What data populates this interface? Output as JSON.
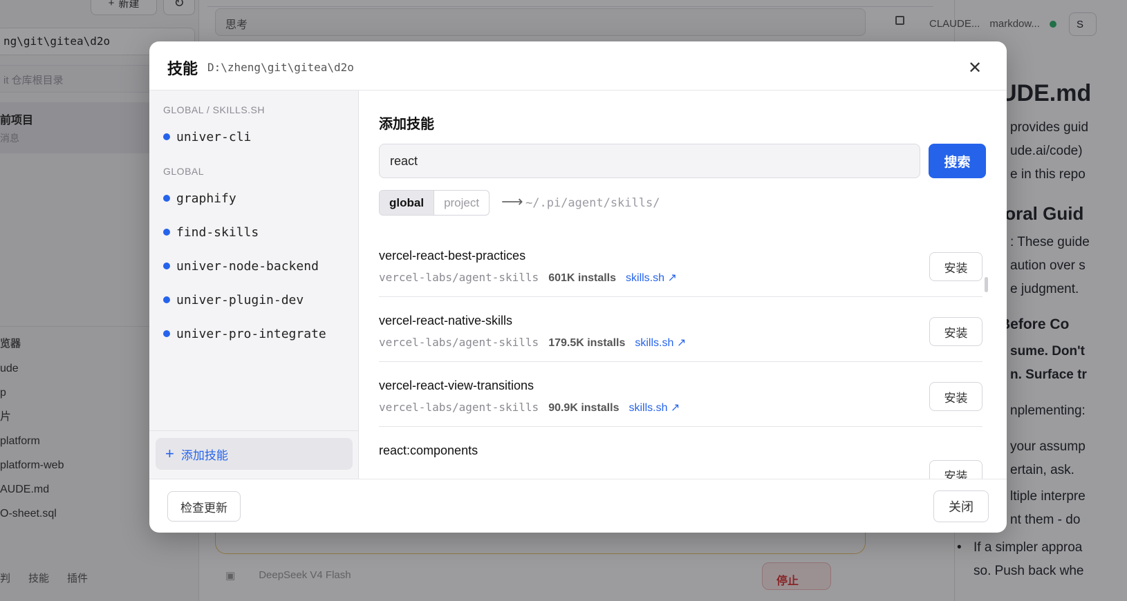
{
  "background": {
    "sidebar": {
      "new_button": "新建",
      "path_value": "ng\\git\\gitea\\d2o",
      "git_placeholder": "it 仓库根目录",
      "project_name": "前项目",
      "project_sub": "消息",
      "browser_title": "览器",
      "files": [
        "ude",
        "p",
        "片",
        "platform",
        "platform-web",
        "AUDE.md",
        "O-sheet.sql"
      ],
      "bottom_tabs": [
        "判",
        "技能",
        "插件"
      ]
    },
    "main": {
      "thinking_label": "思考",
      "model_label": "DeepSeek V4 Flash",
      "stop_label": "停止"
    },
    "right": {
      "tabs": [
        "CLAUDE...",
        "markdow..."
      ],
      "save_label": "S",
      "doc_h1": "UDE.md",
      "doc_lines": [
        "provides guid",
        "ude.ai/code)",
        "e in this repo"
      ],
      "doc_h2": "ioral Guid",
      "doc_para_lines": [
        ": These guide",
        "aution over s",
        "e judgment."
      ],
      "doc_h3": "Before Co",
      "doc_bold_lines": [
        "sume. Don't",
        "n. Surface tr"
      ],
      "doc_more_lines": [
        "nplementing:",
        "your assump",
        "ertain, ask.",
        "ltiple interpre",
        "nt them - do",
        "If a simpler approa",
        "so. Push back whe"
      ]
    }
  },
  "modal": {
    "title": "技能",
    "path": "D:\\zheng\\git\\gitea\\d2o",
    "groups": [
      {
        "title": "GLOBAL / SKILLS.SH",
        "items": [
          "univer-cli"
        ]
      },
      {
        "title": "GLOBAL",
        "items": [
          "graphify",
          "find-skills",
          "univer-node-backend",
          "univer-plugin-dev",
          "univer-pro-integrate"
        ]
      }
    ],
    "add_skill_label": "添加技能",
    "add_section_title": "添加技能",
    "search": {
      "value": "react",
      "button_label": "搜索"
    },
    "scope": {
      "options": [
        "global",
        "project"
      ],
      "selected": "global",
      "arrow": "⟶",
      "target_path": "~/.pi/agent/skills/"
    },
    "results": [
      {
        "name": "vercel-react-best-practices",
        "repo": "vercel-labs/agent-skills",
        "installs": "601K installs",
        "link": "skills.sh ↗",
        "install_label": "安装"
      },
      {
        "name": "vercel-react-native-skills",
        "repo": "vercel-labs/agent-skills",
        "installs": "179.5K installs",
        "link": "skills.sh ↗",
        "install_label": "安装"
      },
      {
        "name": "vercel-react-view-transitions",
        "repo": "vercel-labs/agent-skills",
        "installs": "90.9K installs",
        "link": "skills.sh ↗",
        "install_label": "安装"
      },
      {
        "name": "react:components",
        "repo": "",
        "installs": "",
        "link": "",
        "install_label": "安装"
      }
    ],
    "footer": {
      "check_update_label": "检查更新",
      "close_label": "关闭"
    },
    "accent_color": "#2563eb"
  }
}
